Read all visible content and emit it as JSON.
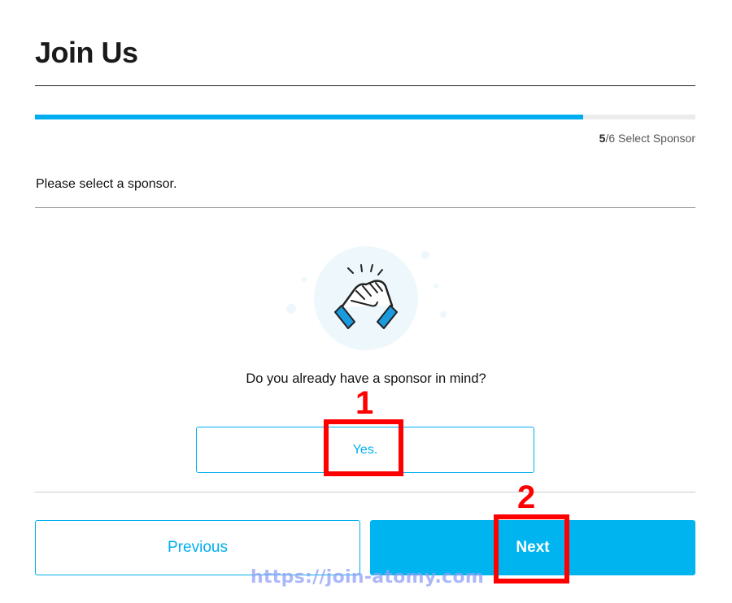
{
  "header": {
    "title": "Join Us"
  },
  "progress": {
    "current": "5",
    "total": "/6",
    "step_label": " Select Sponsor",
    "fraction": 0.83
  },
  "section": {
    "title": "Please select a sponsor."
  },
  "illustration": {
    "icon": "handshake-icon"
  },
  "question": {
    "text": "Do you already have a sponsor in mind?"
  },
  "buttons": {
    "yes_label": "Yes.",
    "previous_label": "Previous",
    "next_label": "Next"
  },
  "annotations": {
    "step1": "1",
    "step2": "2"
  },
  "watermark": {
    "text": "https://join-atomy.com"
  },
  "colors": {
    "accent": "#00aeef",
    "annotation": "#ff0000"
  }
}
